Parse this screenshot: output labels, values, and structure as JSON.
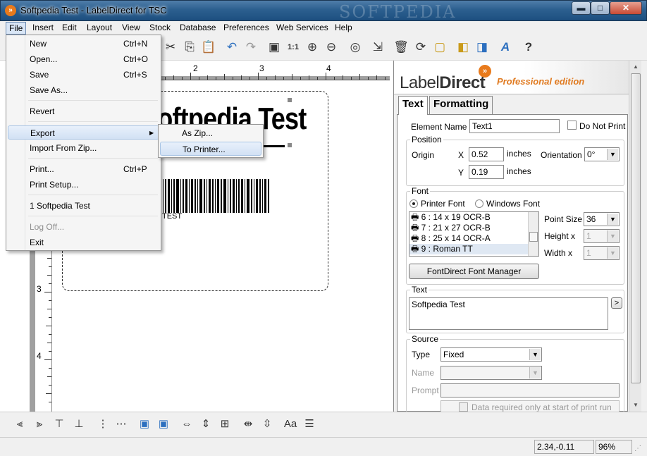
{
  "window": {
    "title": "Softpedia Test - LabelDirect for TSC",
    "watermark": "SOFTPEDIA",
    "min": "▬",
    "max": "□",
    "close": "✕"
  },
  "menubar": [
    "File",
    "Insert",
    "Edit",
    "Layout",
    "View",
    "Stock",
    "Database",
    "Preferences",
    "Web Services",
    "Help"
  ],
  "file_menu": {
    "items": [
      {
        "label": "New",
        "shortcut": "Ctrl+N"
      },
      {
        "label": "Open...",
        "shortcut": "Ctrl+O"
      },
      {
        "label": "Save",
        "shortcut": "Ctrl+S"
      },
      {
        "label": "Save As...",
        "shortcut": ""
      },
      {
        "label": "Revert",
        "shortcut": ""
      },
      {
        "label": "Export",
        "shortcut": ""
      },
      {
        "label": "Import From Zip...",
        "shortcut": ""
      },
      {
        "label": "Print...",
        "shortcut": "Ctrl+P"
      },
      {
        "label": "Print Setup...",
        "shortcut": ""
      },
      {
        "label": "1 Softpedia Test",
        "shortcut": ""
      },
      {
        "label": "Log Off...",
        "shortcut": ""
      },
      {
        "label": "Exit",
        "shortcut": ""
      }
    ],
    "submenu_arrow": "▶"
  },
  "export_submenu": [
    "As Zip...",
    "To Printer..."
  ],
  "toolbar_icons": [
    "cut-icon",
    "copy-icon",
    "paste-icon",
    "undo-icon",
    "redo-icon",
    "actual-size-icon",
    "one-to-one-icon",
    "zoom-in-icon",
    "zoom-out-icon",
    "stock-roll-icon",
    "import-image-icon",
    "delete-icon",
    "refresh-icon",
    "page-icon",
    "bring-front-icon",
    "send-back-icon",
    "text-style-icon",
    "help-icon"
  ],
  "toolbar_glyphs": [
    "✂",
    "⎘",
    "📋",
    "↶",
    "↷",
    "▣",
    "1:1",
    "⊕",
    "⊖",
    "◎",
    "⇲",
    "🗑",
    "⟳",
    "▢",
    "◧",
    "◨",
    "A",
    "?"
  ],
  "ruler": {
    "h_numbers": [
      "2",
      "3",
      "4"
    ],
    "v_numbers": [
      "3",
      "4"
    ]
  },
  "label_canvas": {
    "big_text": "Softpedia Test",
    "barcode_text": "TEST"
  },
  "panel": {
    "logo_main": "Label",
    "logo_bold": "Direct",
    "logo_edition": "Professional edition",
    "logo_swoosh": "»",
    "tabs": [
      "Text",
      "Formatting"
    ],
    "element_name_label": "Element Name",
    "element_name": "Text1",
    "do_not_print": "Do Not Print",
    "position": {
      "title": "Position",
      "origin": "Origin",
      "x_label": "X",
      "x": "0.52",
      "y_label": "Y",
      "y": "0.19",
      "unit": "inches",
      "orientation_label": "Orientation",
      "orientation": "0°"
    },
    "font": {
      "title": "Font",
      "printer_font": "Printer Font",
      "windows_font": "Windows Font",
      "list": [
        "6 : 14 x 19 OCR-B",
        "7 : 21 x 27 OCR-B",
        "8 : 25 x 14 OCR-A",
        "9 : Roman TT"
      ],
      "point_size_label": "Point Size",
      "point_size": "36",
      "height_label": "Height x",
      "height": "1",
      "width_label": "Width x",
      "width": "1",
      "manager_button": "FontDirect Font Manager"
    },
    "text": {
      "title": "Text",
      "value": "Softpedia Test",
      "arrow": ">"
    },
    "source": {
      "title": "Source",
      "type_label": "Type",
      "type": "Fixed",
      "name_label": "Name",
      "name": "",
      "prompt_label": "Prompt",
      "prompt": "",
      "data_required": "Data required only at start of print run"
    }
  },
  "status": {
    "coords": "2.34,-0.11",
    "zoom": "96%"
  }
}
